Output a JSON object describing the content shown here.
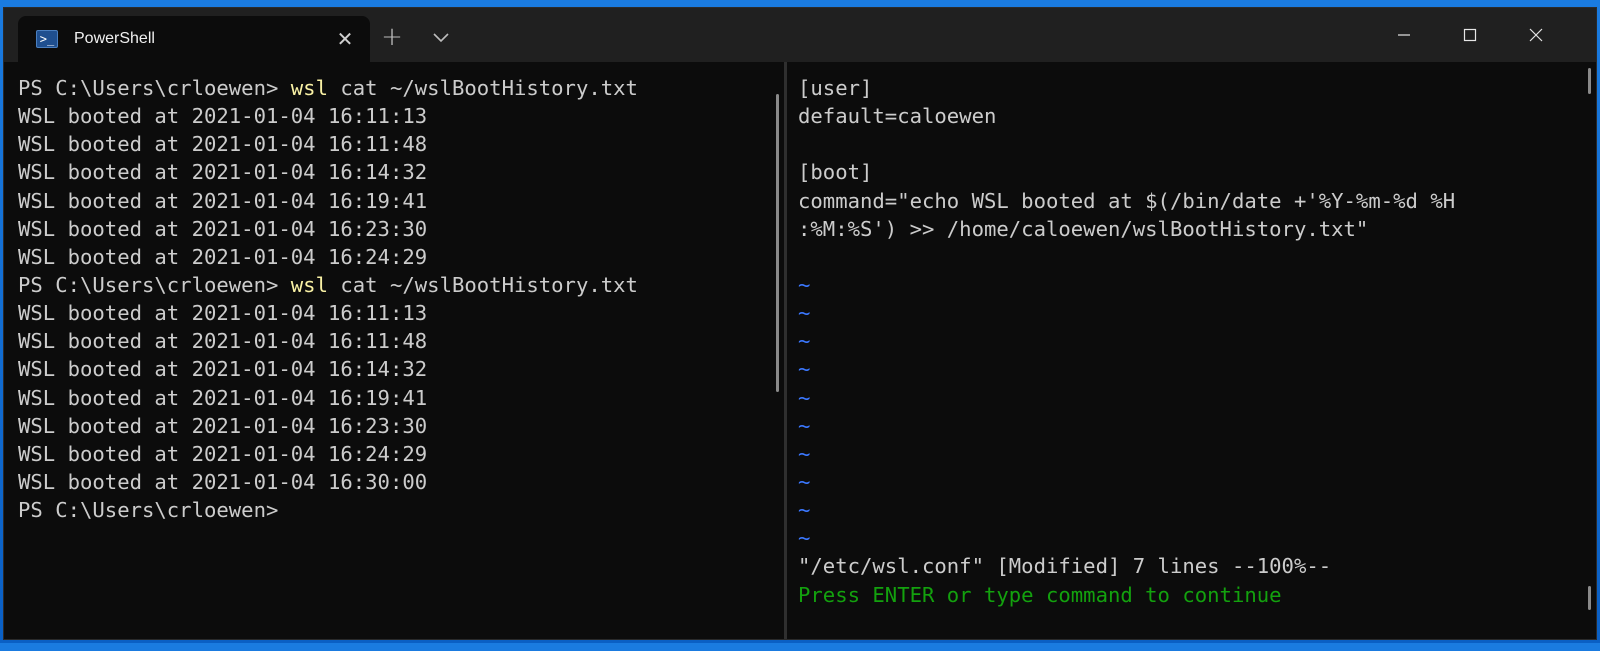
{
  "window": {
    "tab_title": "PowerShell",
    "tab_icon": "powershell-icon"
  },
  "colors": {
    "background": "#0c0c0c",
    "text": "#cccccc",
    "command_keyword": "#f9f1a5",
    "tilde": "#3b78ff",
    "vim_message": "#13a10e"
  },
  "left_pane": {
    "lines": [
      {
        "prompt": "PS C:\\Users\\crloewen> ",
        "keyword": "wsl",
        "rest": " cat ~/wslBootHistory.txt"
      },
      {
        "text": "WSL booted at 2021-01-04 16:11:13"
      },
      {
        "text": "WSL booted at 2021-01-04 16:11:48"
      },
      {
        "text": "WSL booted at 2021-01-04 16:14:32"
      },
      {
        "text": "WSL booted at 2021-01-04 16:19:41"
      },
      {
        "text": "WSL booted at 2021-01-04 16:23:30"
      },
      {
        "text": "WSL booted at 2021-01-04 16:24:29"
      },
      {
        "prompt": "PS C:\\Users\\crloewen> ",
        "keyword": "wsl",
        "rest": " cat ~/wslBootHistory.txt"
      },
      {
        "text": "WSL booted at 2021-01-04 16:11:13"
      },
      {
        "text": "WSL booted at 2021-01-04 16:11:48"
      },
      {
        "text": "WSL booted at 2021-01-04 16:14:32"
      },
      {
        "text": "WSL booted at 2021-01-04 16:19:41"
      },
      {
        "text": "WSL booted at 2021-01-04 16:23:30"
      },
      {
        "text": "WSL booted at 2021-01-04 16:24:29"
      },
      {
        "text": "WSL booted at 2021-01-04 16:30:00"
      },
      {
        "text": "PS C:\\Users\\crloewen>"
      }
    ]
  },
  "right_pane": {
    "file_lines": [
      "[user]",
      "default=caloewen",
      "",
      "[boot]",
      "command=\"echo WSL booted at $(/bin/date +'%Y-%m-%d %H",
      ":%M:%S') >> /home/caloewen/wslBootHistory.txt\"",
      ""
    ],
    "tilde_lines": [
      "~",
      "~",
      "~",
      "~",
      "~",
      "~",
      "~",
      "~",
      "~",
      "~"
    ],
    "status_line": "\"/etc/wsl.conf\" [Modified] 7 lines --100%--",
    "message_line": "Press ENTER or type command to continue"
  }
}
